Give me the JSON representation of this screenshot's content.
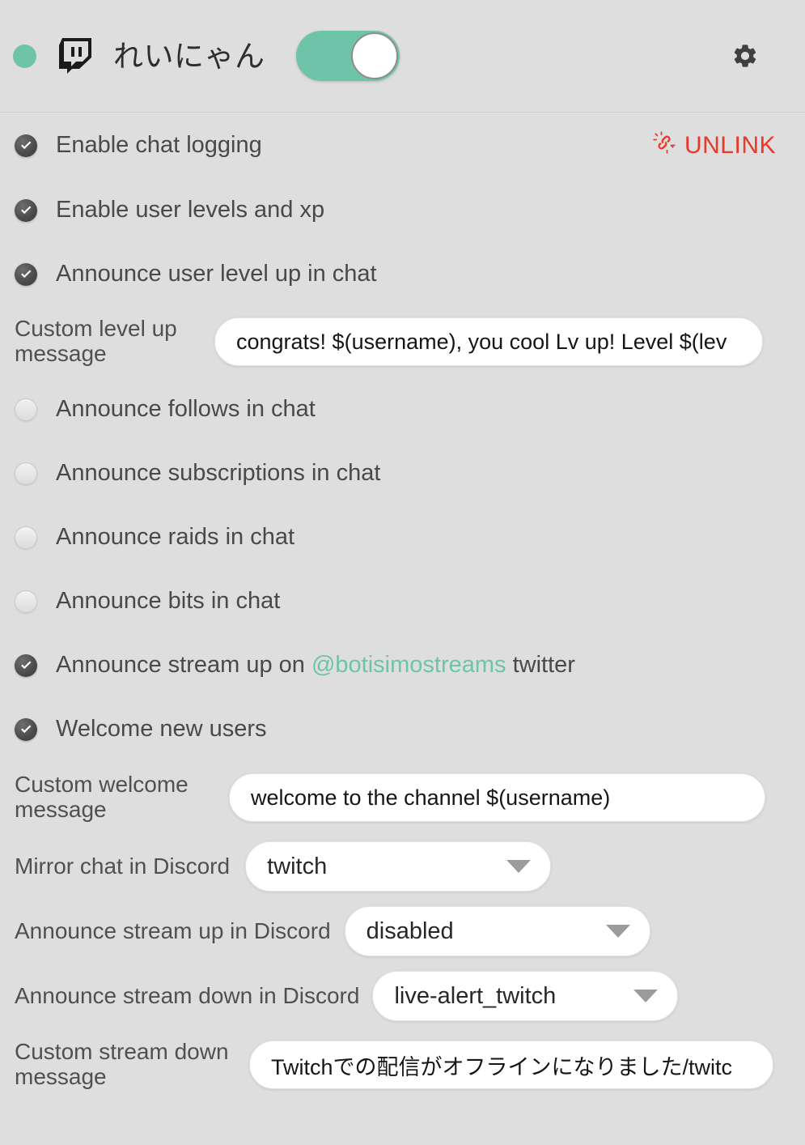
{
  "header": {
    "status_indicator": "online",
    "platform_icon": "twitch-icon",
    "channel_name": "れいにゃん",
    "toggle_state": "on",
    "settings_icon": "gear-icon"
  },
  "settings": {
    "unlink": {
      "label": "UNLINK",
      "icon": "broken-link-icon",
      "color": "#e8392a"
    },
    "checkboxes": [
      {
        "label": "Enable chat logging",
        "checked": true
      },
      {
        "label": "Enable user levels and xp",
        "checked": true
      },
      {
        "label": "Announce user level up in chat",
        "checked": true
      },
      {
        "label": "Announce follows in chat",
        "checked": false
      },
      {
        "label": "Announce subscriptions in chat",
        "checked": false
      },
      {
        "label": "Announce raids in chat",
        "checked": false
      },
      {
        "label": "Announce bits in chat",
        "checked": false
      },
      {
        "label": "Welcome new users",
        "checked": true
      }
    ],
    "twitter_row": {
      "prefix": "Announce stream up on ",
      "handle": "@botisimostreams",
      "suffix": " twitter",
      "checked": true,
      "handle_color": "#6ec4a8"
    },
    "fields": {
      "level_up_message": {
        "label": "Custom level up message",
        "value": "congrats! $(username), you cool Lv up! Level $(lev"
      },
      "welcome_message": {
        "label": "Custom welcome message",
        "value": "welcome to the channel $(username)"
      },
      "stream_down_message": {
        "label": "Custom stream down message",
        "value": "Twitchでの配信がオフラインになりました/twitc"
      }
    },
    "dropdowns": {
      "mirror_chat": {
        "label": "Mirror chat in Discord",
        "value": "twitch"
      },
      "announce_stream_up": {
        "label": "Announce stream up in Discord",
        "value": "disabled"
      },
      "announce_stream_down": {
        "label": "Announce stream down in Discord",
        "value": "live-alert_twitch"
      }
    }
  },
  "colors": {
    "background": "#dedede",
    "accent_green": "#6ec4a8",
    "danger_red": "#e8392a",
    "text": "#494949"
  }
}
